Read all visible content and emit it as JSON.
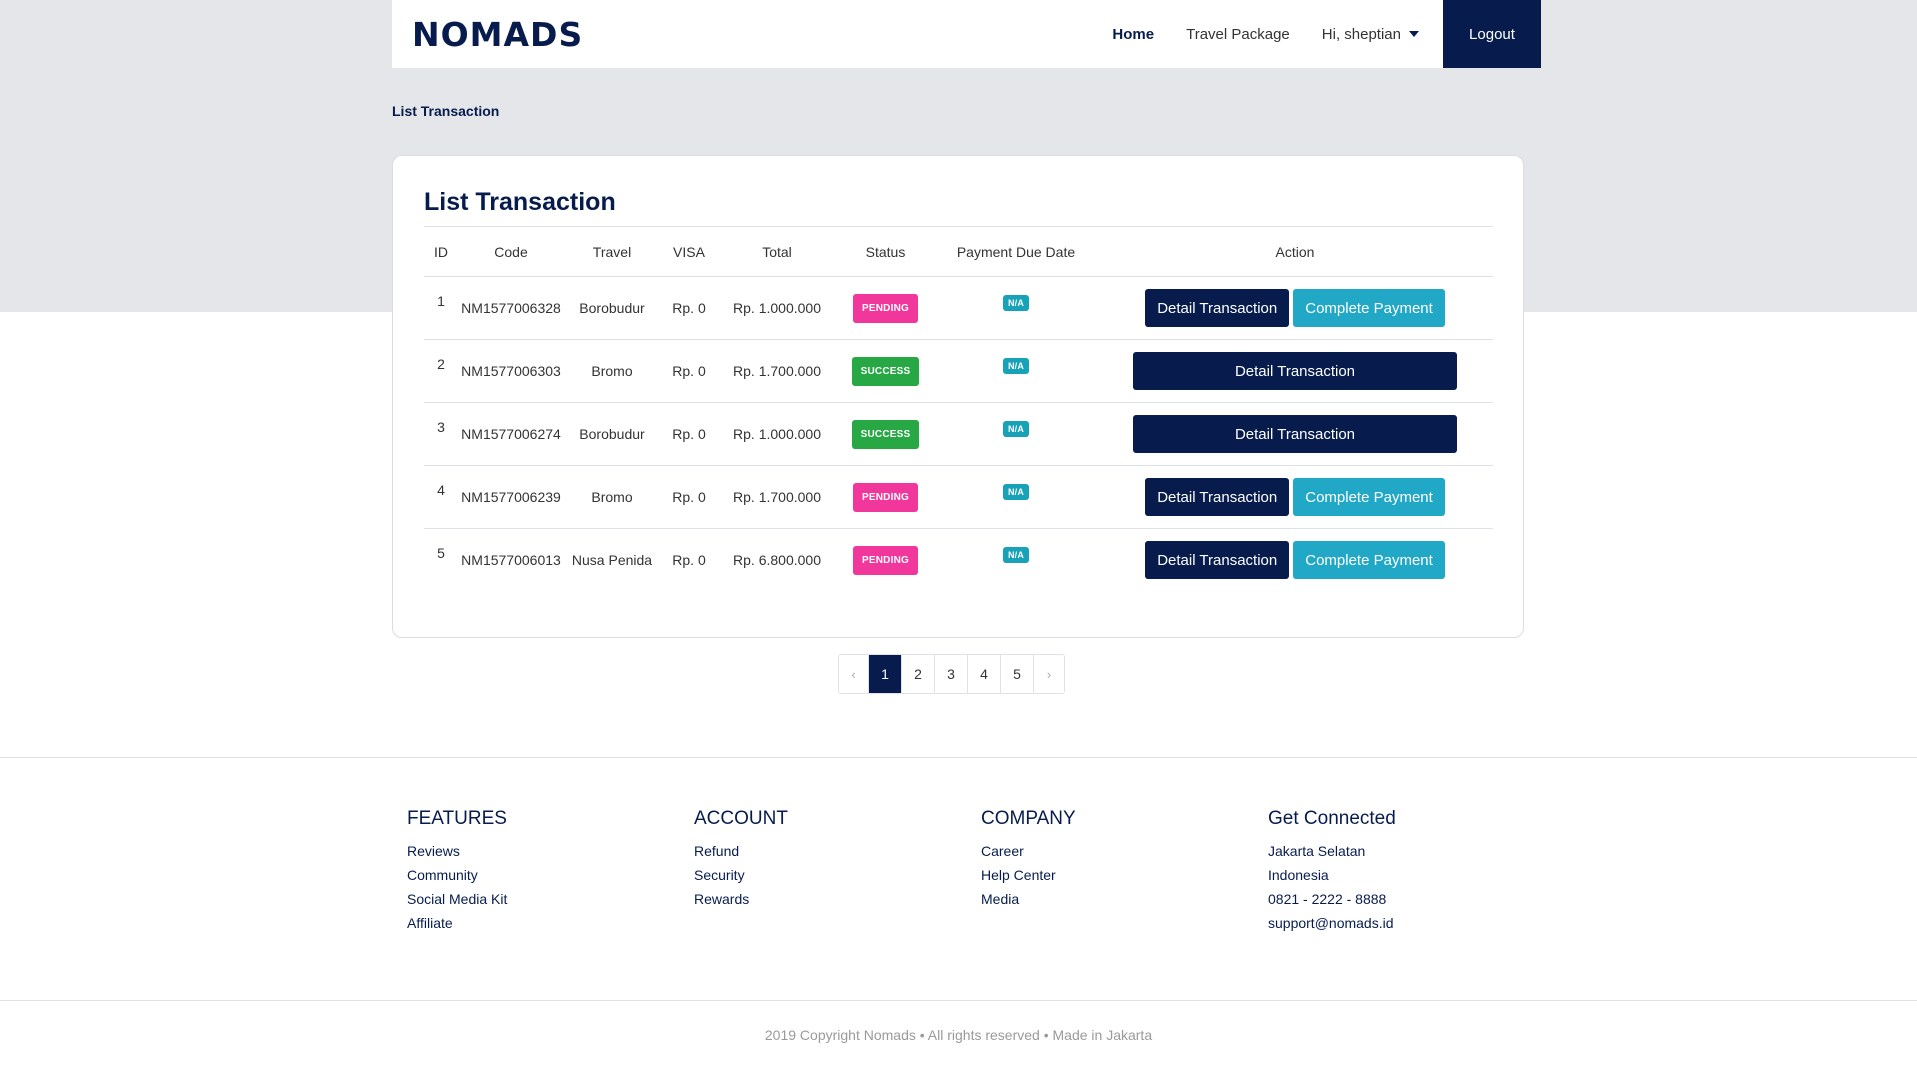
{
  "brand": {
    "logo": "NOMADS"
  },
  "nav": {
    "home": "Home",
    "travel_package": "Travel Package",
    "user": "Hi, sheptian",
    "logout": "Logout"
  },
  "breadcrumb": "List Transaction",
  "card": {
    "title": "List Transaction",
    "headers": [
      "ID",
      "Code",
      "Travel",
      "VISA",
      "Total",
      "Status",
      "Payment Due Date",
      "Action"
    ],
    "rows": [
      {
        "id": "1",
        "code": "NM1577006328",
        "travel": "Borobudur",
        "visa": "Rp. 0",
        "total": "Rp. 1.000.000",
        "status": "PENDING",
        "due": "N/A",
        "detail": "Detail Transaction",
        "pay": "Complete Payment"
      },
      {
        "id": "2",
        "code": "NM1577006303",
        "travel": "Bromo",
        "visa": "Rp. 0",
        "total": "Rp. 1.700.000",
        "status": "SUCCESS",
        "due": "N/A",
        "detail": "Detail Transaction"
      },
      {
        "id": "3",
        "code": "NM1577006274",
        "travel": "Borobudur",
        "visa": "Rp. 0",
        "total": "Rp. 1.000.000",
        "status": "SUCCESS",
        "due": "N/A",
        "detail": "Detail Transaction"
      },
      {
        "id": "4",
        "code": "NM1577006239",
        "travel": "Bromo",
        "visa": "Rp. 0",
        "total": "Rp. 1.700.000",
        "status": "PENDING",
        "due": "N/A",
        "detail": "Detail Transaction",
        "pay": "Complete Payment"
      },
      {
        "id": "5",
        "code": "NM1577006013",
        "travel": "Nusa Penida",
        "visa": "Rp. 0",
        "total": "Rp. 6.800.000",
        "status": "PENDING",
        "due": "N/A",
        "detail": "Detail Transaction",
        "pay": "Complete Payment"
      }
    ]
  },
  "pagination": {
    "prev": "‹",
    "pages": [
      "1",
      "2",
      "3",
      "4",
      "5"
    ],
    "next": "›",
    "active": "1"
  },
  "footer": {
    "columns": [
      {
        "title": "FEATURES",
        "items": [
          "Reviews",
          "Community",
          "Social Media Kit",
          "Affiliate"
        ]
      },
      {
        "title": "ACCOUNT",
        "items": [
          "Refund",
          "Security",
          "Rewards"
        ]
      },
      {
        "title": "COMPANY",
        "items": [
          "Career",
          "Help Center",
          "Media"
        ]
      },
      {
        "title": "Get Connected",
        "items": [
          "Jakarta Selatan",
          "Indonesia",
          "0821 - 2222 - 8888",
          "support@nomads.id"
        ]
      }
    ],
    "copyright": "2019 Copyright Nomads • All rights reserved • Made in Jakarta"
  },
  "colors": {
    "primary": "#071c4d",
    "pending": "#f2379c",
    "success": "#28a745",
    "info": "#17a2b8",
    "pay": "#20a8c6"
  }
}
